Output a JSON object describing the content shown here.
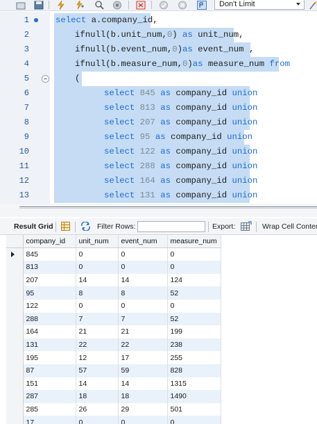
{
  "toolbar": {
    "icons": [
      "open-folder-icon",
      "save-icon",
      "execute-lightning-icon",
      "execute-current-icon",
      "explain-magnifier-icon",
      "stop-icon",
      "toggle-icon",
      "commit-icon",
      "rollback-icon",
      "autocommit-icon"
    ],
    "limit_value": "Don't Limit"
  },
  "editor": {
    "lines": [
      {
        "n": "1",
        "indent": 0
      },
      {
        "n": "2",
        "indent": 1
      },
      {
        "n": "3",
        "indent": 1
      },
      {
        "n": "4",
        "indent": 1
      },
      {
        "n": "5",
        "indent": 1
      },
      {
        "n": "6",
        "indent": 2
      },
      {
        "n": "7",
        "indent": 2
      },
      {
        "n": "8",
        "indent": 2
      },
      {
        "n": "9",
        "indent": 2
      },
      {
        "n": "10",
        "indent": 2
      },
      {
        "n": "11",
        "indent": 2
      },
      {
        "n": "12",
        "indent": 2
      },
      {
        "n": "13",
        "indent": 2
      }
    ],
    "code": [
      [
        [
          "kw",
          "select"
        ],
        [
          "t",
          " a.company_id,"
        ]
      ],
      [
        [
          "t",
          "ifnull(b.unit_num,"
        ],
        [
          "num",
          "0"
        ],
        [
          "t",
          ") "
        ],
        [
          "kw",
          "as"
        ],
        [
          "t",
          " unit_num,"
        ]
      ],
      [
        [
          "t",
          "ifnull(b.event_num,"
        ],
        [
          "num",
          "0"
        ],
        [
          "t",
          ")"
        ],
        [
          "kw",
          "as"
        ],
        [
          "t",
          " event_num ,"
        ]
      ],
      [
        [
          "t",
          "ifnull(b.measure_num,"
        ],
        [
          "num",
          "0"
        ],
        [
          "t",
          ")"
        ],
        [
          "kw",
          "as"
        ],
        [
          "t",
          " measure_num "
        ],
        [
          "kw",
          "from"
        ]
      ],
      [
        [
          "t",
          "("
        ]
      ],
      [
        [
          "kw",
          "select"
        ],
        [
          "t",
          " "
        ],
        [
          "num",
          "845"
        ],
        [
          "t",
          " "
        ],
        [
          "kw",
          "as"
        ],
        [
          "t",
          " company_id "
        ],
        [
          "kw",
          "union"
        ]
      ],
      [
        [
          "kw",
          "select"
        ],
        [
          "t",
          " "
        ],
        [
          "num",
          "813"
        ],
        [
          "t",
          " "
        ],
        [
          "kw",
          "as"
        ],
        [
          "t",
          " company_id "
        ],
        [
          "kw",
          "union"
        ]
      ],
      [
        [
          "kw",
          "select"
        ],
        [
          "t",
          " "
        ],
        [
          "num",
          "207"
        ],
        [
          "t",
          " "
        ],
        [
          "kw",
          "as"
        ],
        [
          "t",
          " company_id "
        ],
        [
          "kw",
          "union"
        ]
      ],
      [
        [
          "kw",
          "select"
        ],
        [
          "t",
          " "
        ],
        [
          "num",
          "95"
        ],
        [
          "t",
          " "
        ],
        [
          "kw",
          "as"
        ],
        [
          "t",
          " company_id "
        ],
        [
          "kw",
          "union"
        ]
      ],
      [
        [
          "kw",
          "select"
        ],
        [
          "t",
          " "
        ],
        [
          "num",
          "122"
        ],
        [
          "t",
          " "
        ],
        [
          "kw",
          "as"
        ],
        [
          "t",
          " company_id "
        ],
        [
          "kw",
          "union"
        ]
      ],
      [
        [
          "kw",
          "select"
        ],
        [
          "t",
          " "
        ],
        [
          "num",
          "288"
        ],
        [
          "t",
          " "
        ],
        [
          "kw",
          "as"
        ],
        [
          "t",
          " company_id "
        ],
        [
          "kw",
          "union"
        ]
      ],
      [
        [
          "kw",
          "select"
        ],
        [
          "t",
          " "
        ],
        [
          "num",
          "164"
        ],
        [
          "t",
          " "
        ],
        [
          "kw",
          "as"
        ],
        [
          "t",
          " company_id "
        ],
        [
          "kw",
          "union"
        ]
      ],
      [
        [
          "kw",
          "select"
        ],
        [
          "t",
          " "
        ],
        [
          "num",
          "131"
        ],
        [
          "t",
          " "
        ],
        [
          "kw",
          "as"
        ],
        [
          "t",
          " company_id "
        ],
        [
          "kw",
          "union"
        ]
      ]
    ],
    "colors": {
      "keyword": "#1e6ad6",
      "number": "#7d8a97",
      "selection": "#c5dcf4"
    }
  },
  "result_toolbar": {
    "result_grid_label": "Result Grid",
    "filter_rows_label": "Filter Rows:",
    "filter_value": "",
    "export_label": "Export:",
    "wrap_cell_label": "Wrap Cell Conten"
  },
  "grid": {
    "columns": [
      "company_id",
      "unit_num",
      "event_num",
      "measure_num"
    ],
    "rows": [
      [
        "845",
        "0",
        "0",
        "0"
      ],
      [
        "813",
        "0",
        "0",
        "0"
      ],
      [
        "207",
        "14",
        "14",
        "124"
      ],
      [
        "95",
        "8",
        "8",
        "52"
      ],
      [
        "122",
        "0",
        "0",
        "0"
      ],
      [
        "288",
        "7",
        "7",
        "52"
      ],
      [
        "164",
        "21",
        "21",
        "199"
      ],
      [
        "131",
        "22",
        "22",
        "238"
      ],
      [
        "195",
        "12",
        "17",
        "255"
      ],
      [
        "87",
        "57",
        "59",
        "828"
      ],
      [
        "151",
        "14",
        "14",
        "1315"
      ],
      [
        "287",
        "18",
        "18",
        "1490"
      ],
      [
        "285",
        "26",
        "29",
        "501"
      ],
      [
        "17",
        "0",
        "0",
        "0"
      ]
    ]
  }
}
